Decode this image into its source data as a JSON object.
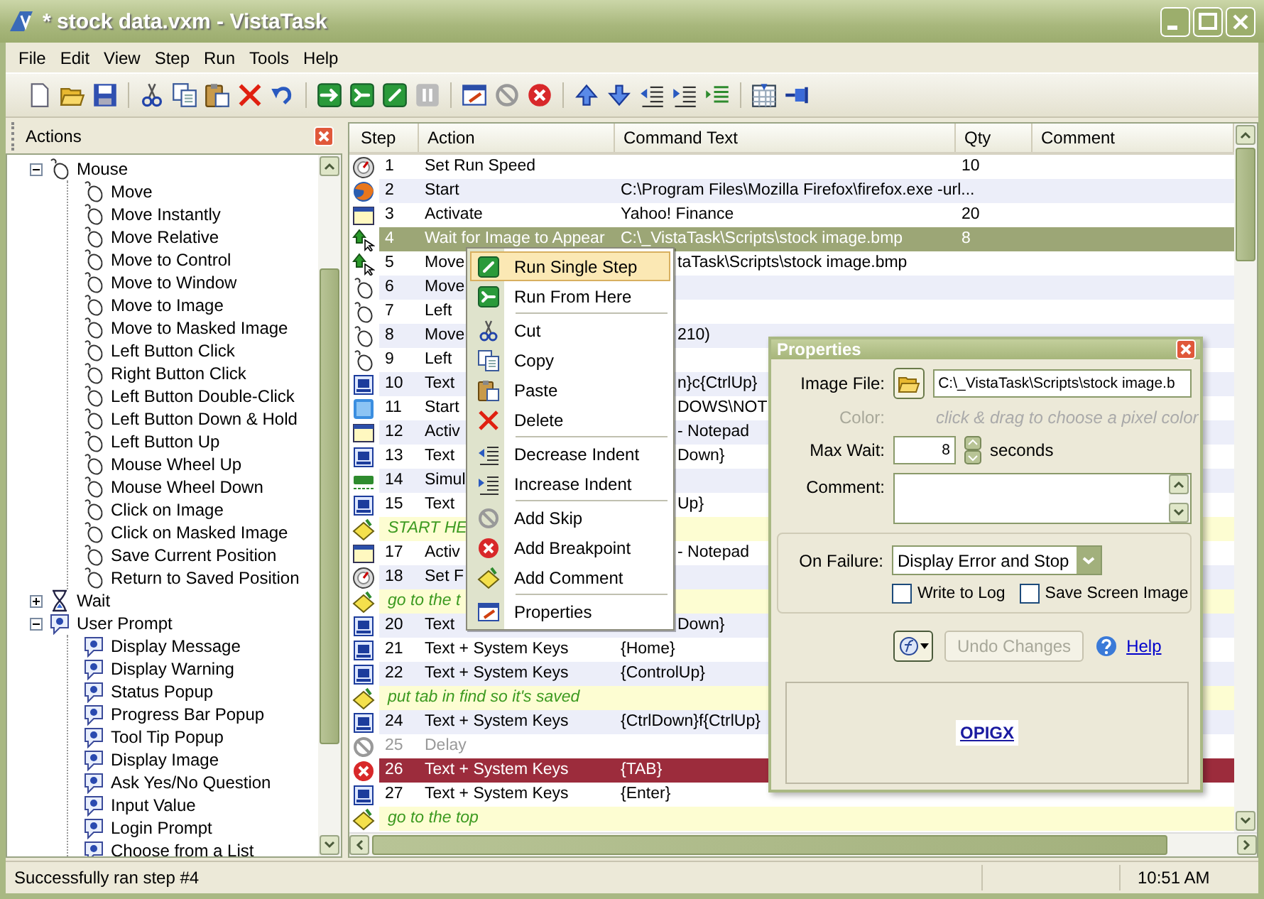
{
  "window": {
    "title": "* stock data.vxm - VistaTask"
  },
  "menu_bar": [
    "File",
    "Edit",
    "View",
    "Step",
    "Run",
    "Tools",
    "Help"
  ],
  "actions_panel": {
    "title": "Actions",
    "tree": [
      {
        "label": "Mouse",
        "kind": "mouse",
        "expanded": true,
        "children": [
          {
            "label": "Move"
          },
          {
            "label": "Move Instantly"
          },
          {
            "label": "Move Relative"
          },
          {
            "label": "Move to Control"
          },
          {
            "label": "Move to Window"
          },
          {
            "label": "Move to Image"
          },
          {
            "label": "Move to Masked Image"
          },
          {
            "label": "Left Button Click"
          },
          {
            "label": "Right Button Click"
          },
          {
            "label": "Left Button Double-Click"
          },
          {
            "label": "Left Button Down & Hold"
          },
          {
            "label": "Left Button Up"
          },
          {
            "label": "Mouse Wheel Up"
          },
          {
            "label": "Mouse Wheel Down"
          },
          {
            "label": "Click on Image"
          },
          {
            "label": "Click on Masked Image"
          },
          {
            "label": "Save Current Position"
          },
          {
            "label": "Return to Saved Position"
          }
        ]
      },
      {
        "label": "Wait",
        "kind": "wait",
        "expanded": false
      },
      {
        "label": "User Prompt",
        "kind": "prompt",
        "expanded": true,
        "children": [
          {
            "label": "Display Message"
          },
          {
            "label": "Display Warning"
          },
          {
            "label": "Status Popup"
          },
          {
            "label": "Progress Bar Popup"
          },
          {
            "label": "Tool Tip Popup"
          },
          {
            "label": "Display Image"
          },
          {
            "label": "Ask Yes/No Question"
          },
          {
            "label": "Input Value"
          },
          {
            "label": "Login Prompt"
          },
          {
            "label": "Choose from a List"
          }
        ]
      }
    ]
  },
  "table": {
    "columns": [
      "Step",
      "Action",
      "Command Text",
      "Qty",
      "Comment"
    ],
    "rows": [
      {
        "kind": "speed",
        "step": "1",
        "action": "Set Run Speed",
        "qty": "10",
        "selected": false,
        "skipped": false,
        "breakpoint": false
      },
      {
        "kind": "firefox",
        "step": "2",
        "action": "Start",
        "command": "C:\\Program Files\\Mozilla Firefox\\firefox.exe -url...",
        "selected": false,
        "skipped": false,
        "breakpoint": false
      },
      {
        "kind": "window",
        "step": "3",
        "action": "Activate",
        "command": "Yahoo! Finance",
        "qty": "20",
        "selected": false,
        "skipped": false,
        "breakpoint": false
      },
      {
        "kind": "image",
        "step": "4",
        "action": "Wait for Image to Appear",
        "command": "C:\\_VistaTask\\Scripts\\stock image.bmp",
        "qty": "8",
        "selected": true,
        "skipped": false,
        "breakpoint": false
      },
      {
        "kind": "image",
        "step": "5",
        "action": "Move",
        "command": "taTask\\Scripts\\stock image.bmp",
        "cut": true,
        "selected": false,
        "skipped": false,
        "breakpoint": false
      },
      {
        "kind": "mouse",
        "step": "6",
        "action": "Move",
        "selected": false,
        "skipped": false,
        "breakpoint": false
      },
      {
        "kind": "mouse",
        "step": "7",
        "action": "Left",
        "selected": false,
        "skipped": false,
        "breakpoint": false
      },
      {
        "kind": "mouse",
        "step": "8",
        "action": "Move",
        "command": "210)",
        "cut": true,
        "selected": false,
        "skipped": false,
        "breakpoint": false
      },
      {
        "kind": "mouse",
        "step": "9",
        "action": "Left",
        "selected": false,
        "skipped": false,
        "breakpoint": false
      },
      {
        "kind": "text",
        "step": "10",
        "action": "Text",
        "command": "n}c{CtrlUp}",
        "cut": true,
        "selected": false,
        "skipped": false,
        "breakpoint": false
      },
      {
        "kind": "app",
        "step": "11",
        "action": "Start",
        "command": "DOWS\\NOT",
        "cut": true,
        "selected": false,
        "skipped": false,
        "breakpoint": false
      },
      {
        "kind": "window",
        "step": "12",
        "action": "Activ",
        "command": "- Notepad",
        "cut": true,
        "selected": false,
        "skipped": false,
        "breakpoint": false
      },
      {
        "kind": "text",
        "step": "13",
        "action": "Text",
        "command": "Down}",
        "cut": true,
        "selected": false,
        "skipped": false,
        "breakpoint": false
      },
      {
        "kind": "typing",
        "step": "14",
        "action": "Simul",
        "selected": false,
        "skipped": false,
        "breakpoint": false
      },
      {
        "kind": "text",
        "step": "15",
        "action": "Text",
        "command": "Up}",
        "cut": true,
        "selected": false,
        "skipped": false,
        "breakpoint": false
      },
      {
        "kind": "comment",
        "text": "START HE",
        "selected": false
      },
      {
        "kind": "window",
        "step": "17",
        "action": "Activ",
        "command": "- Notepad",
        "cut": true,
        "selected": false,
        "skipped": false,
        "breakpoint": false
      },
      {
        "kind": "speed",
        "step": "18",
        "action": "Set F",
        "selected": false,
        "skipped": false,
        "breakpoint": false
      },
      {
        "kind": "comment",
        "text": "go to the t",
        "selected": false
      },
      {
        "kind": "text",
        "step": "20",
        "action": "Text",
        "command": "Down}",
        "cut": true,
        "selected": false,
        "skipped": false,
        "breakpoint": false
      },
      {
        "kind": "text",
        "step": "21",
        "action": "Text + System Keys",
        "command": "{Home}",
        "selected": false,
        "skipped": false,
        "breakpoint": false
      },
      {
        "kind": "text",
        "step": "22",
        "action": "Text + System Keys",
        "command": "{ControlUp}",
        "selected": false,
        "skipped": false,
        "breakpoint": false
      },
      {
        "kind": "comment",
        "text": "put tab in find so it's saved",
        "selected": false
      },
      {
        "kind": "text",
        "step": "24",
        "action": "Text + System Keys",
        "command": "{CtrlDown}f{CtrlUp}",
        "selected": false,
        "skipped": false,
        "breakpoint": false
      },
      {
        "kind": "delay",
        "step": "25",
        "action": "Delay",
        "selected": false,
        "skipped": true,
        "breakpoint": false
      },
      {
        "kind": "text",
        "step": "26",
        "action": "Text + System Keys",
        "command": "{TAB}",
        "selected": false,
        "skipped": false,
        "breakpoint": true
      },
      {
        "kind": "text",
        "step": "27",
        "action": "Text + System Keys",
        "command": "{Enter}",
        "selected": false,
        "skipped": false,
        "breakpoint": false
      },
      {
        "kind": "comment",
        "text": "go to the top",
        "selected": false
      }
    ]
  },
  "context_menu": {
    "groups": [
      [
        {
          "label": "Run Single Step",
          "kind": "runsingle",
          "selected": true
        },
        {
          "label": "Run From Here",
          "kind": "runfrom",
          "selected": false
        }
      ],
      [
        {
          "label": "Cut",
          "kind": "cut",
          "selected": false
        },
        {
          "label": "Copy",
          "kind": "copy",
          "selected": false
        },
        {
          "label": "Paste",
          "kind": "paste",
          "selected": false
        },
        {
          "label": "Delete",
          "kind": "delete",
          "selected": false
        }
      ],
      [
        {
          "label": "Decrease Indent",
          "kind": "outdent",
          "selected": false
        },
        {
          "label": "Increase Indent",
          "kind": "indent",
          "selected": false
        }
      ],
      [
        {
          "label": "Add Skip",
          "kind": "skip",
          "selected": false
        },
        {
          "label": "Add Breakpoint",
          "kind": "error",
          "selected": false
        },
        {
          "label": "Add Comment",
          "kind": "note",
          "selected": false
        }
      ],
      [
        {
          "label": "Properties",
          "kind": "properties",
          "selected": false
        }
      ]
    ]
  },
  "properties": {
    "title": "Properties",
    "image_file": {
      "label": "Image File:",
      "value": "C:\\_VistaTask\\Scripts\\stock image.b"
    },
    "color": {
      "label": "Color:",
      "hint": "click & drag to choose a pixel color",
      "disabled": true
    },
    "max_wait": {
      "label": "Max Wait:",
      "value": "8",
      "unit": "seconds"
    },
    "comment": {
      "label": "Comment:"
    },
    "on_failure": {
      "label": "On Failure:",
      "value": "Display Error and Stop"
    },
    "checkboxes": [
      {
        "label": "Write to Log",
        "checked": false
      },
      {
        "label": "Save Screen Image",
        "checked": false
      }
    ],
    "undo": {
      "label": "Undo Changes",
      "disabled": true
    },
    "help": "Help",
    "preview_text": "OPIGX"
  },
  "status_bar": {
    "message": "Successfully ran step #4",
    "time": "10:51 AM"
  }
}
